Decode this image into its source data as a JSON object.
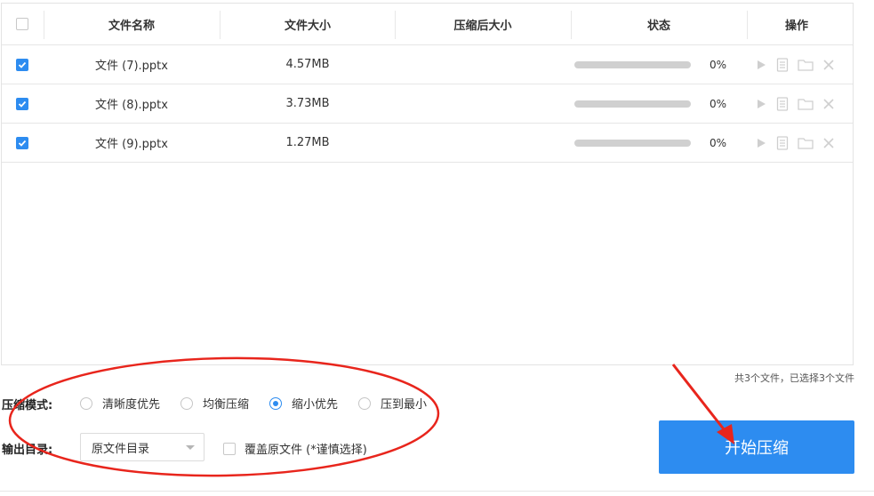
{
  "table": {
    "headers": {
      "name": "文件名称",
      "size": "文件大小",
      "compressed_size": "压缩后大小",
      "status": "状态",
      "actions": "操作"
    },
    "rows": [
      {
        "checked": true,
        "name": "文件 (7).pptx",
        "size": "4.57MB",
        "compressed_size": "",
        "progress": 0,
        "progress_text": "0%"
      },
      {
        "checked": true,
        "name": "文件 (8).pptx",
        "size": "3.73MB",
        "compressed_size": "",
        "progress": 0,
        "progress_text": "0%"
      },
      {
        "checked": true,
        "name": "文件 (9).pptx",
        "size": "1.27MB",
        "compressed_size": "",
        "progress": 0,
        "progress_text": "0%"
      }
    ],
    "row_action_icons": [
      "play-icon",
      "document-icon",
      "folder-icon",
      "close-icon"
    ],
    "count_text": "共3个文件，已选择3个文件"
  },
  "options": {
    "mode_label": "压缩模式:",
    "modes": [
      {
        "label": "清晰度优先",
        "selected": false
      },
      {
        "label": "均衡压缩",
        "selected": false
      },
      {
        "label": "缩小优先",
        "selected": true
      },
      {
        "label": "压到最小",
        "selected": false
      }
    ],
    "output_label": "输出目录:",
    "output_select_value": "原文件目录",
    "overwrite_label": "覆盖原文件 (*谨慎选择)",
    "overwrite_checked": false
  },
  "start_button": "开始压缩",
  "colors": {
    "accent": "#2d8cf0",
    "annotation": "#e8251c"
  }
}
